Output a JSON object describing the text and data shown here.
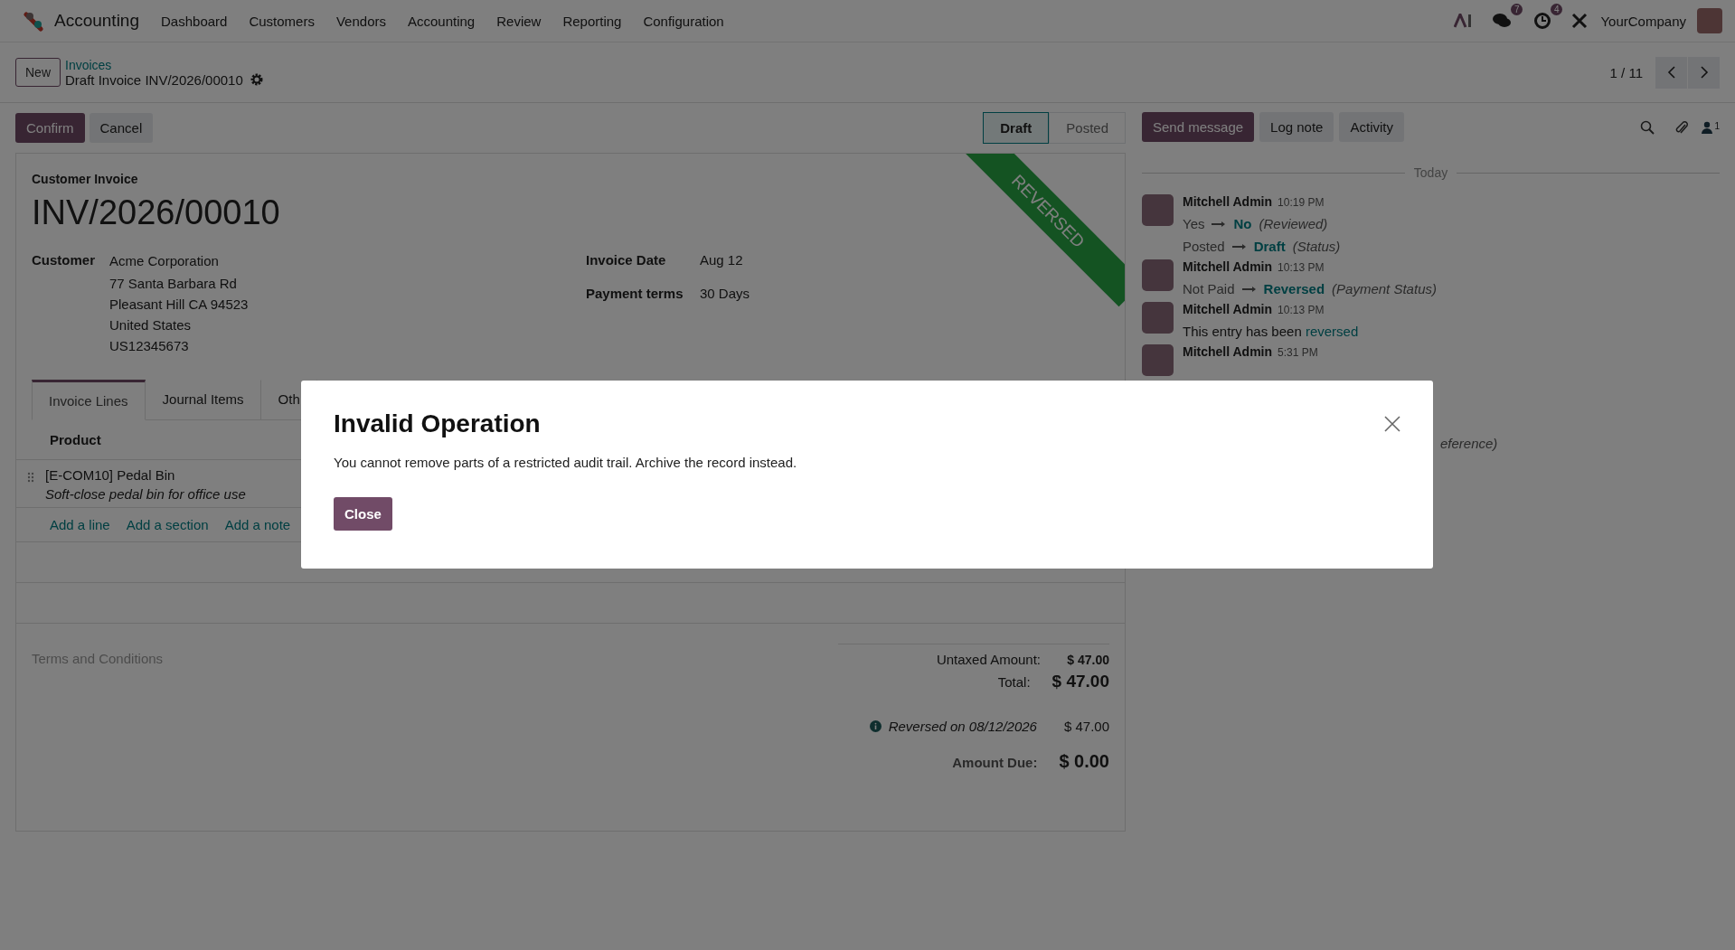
{
  "navbar": {
    "app_name": "Accounting",
    "menu": [
      "Dashboard",
      "Customers",
      "Vendors",
      "Accounting",
      "Review",
      "Reporting",
      "Configuration"
    ],
    "badges": [
      {
        "kind": "chat",
        "count": "7"
      },
      {
        "kind": "activity",
        "count": "4"
      }
    ],
    "company": "YourCompany"
  },
  "control_panel": {
    "new_button": "New",
    "breadcrumb": "Invoices",
    "record_title": "Draft Invoice INV/2026/00010",
    "pager": "1 / 11"
  },
  "actions": [
    {
      "label": "Confirm",
      "kind": "primary"
    },
    {
      "label": "Cancel",
      "kind": "secondary"
    }
  ],
  "statusbar": [
    {
      "label": "Draft",
      "selected": true
    },
    {
      "label": "Posted",
      "selected": false
    }
  ],
  "form": {
    "type_label": "Customer Invoice",
    "name": "INV/2026/00010",
    "ribbon": "REVERSED",
    "customer_label": "Customer",
    "customer_lines": [
      "Acme Corporation",
      "77 Santa Barbara Rd",
      "Pleasant Hill CA 94523",
      "United States",
      "US12345673"
    ],
    "fields": [
      {
        "label": "Invoice Date",
        "value": "Aug 12"
      },
      {
        "label": "Payment terms",
        "value": "30 Days"
      }
    ],
    "tabs": [
      {
        "label": "Invoice Lines",
        "selected": true
      },
      {
        "label": "Journal Items",
        "selected": false
      },
      {
        "label": "Oth",
        "selected": false
      }
    ],
    "column": "Product",
    "lines": [
      {
        "product": "[E-COM10] Pedal Bin",
        "description": "Soft-close pedal bin for office use"
      }
    ],
    "add_links": [
      "Add a line",
      "Add a section",
      "Add a note"
    ],
    "terms_placeholder": "Terms and Conditions",
    "totals": [
      {
        "kind": "subtotal",
        "label": "Untaxed Amount:",
        "value": "$ 47.00"
      },
      {
        "kind": "total",
        "label": "Total:",
        "value": "$ 47.00"
      }
    ],
    "payments": [
      {
        "label": "Reversed on 08/12/2026",
        "amount": "$ 47.00"
      }
    ],
    "amount_due": {
      "label": "Amount Due:",
      "value": "$ 0.00"
    }
  },
  "chatter": {
    "buttons": [
      {
        "label": "Send message",
        "kind": "primary"
      },
      {
        "label": "Log note",
        "kind": "secondary"
      },
      {
        "label": "Activity",
        "kind": "secondary"
      }
    ],
    "followers": "1",
    "day": "Today",
    "messages": [
      {
        "author": "Mitchell Admin",
        "time": "10:19 PM",
        "lines": [
          {
            "kind": "tracking",
            "old": "Yes",
            "new": "No",
            "field": "(Reviewed)"
          },
          {
            "kind": "tracking",
            "old": "Posted",
            "new": "Draft",
            "field": "(Status)"
          }
        ]
      },
      {
        "author": "Mitchell Admin",
        "time": "10:13 PM",
        "lines": [
          {
            "kind": "tracking",
            "old": "Not Paid",
            "new": "Reversed",
            "field": "(Payment Status)"
          }
        ]
      },
      {
        "author": "Mitchell Admin",
        "time": "10:13 PM",
        "lines": [
          {
            "kind": "text",
            "text": "This entry has been",
            "link": "reversed"
          }
        ]
      },
      {
        "author": "Mitchell Admin",
        "time": "5:31 PM"
      }
    ],
    "hidden_fragment": "eference)"
  },
  "dialog": {
    "title": "Invalid Operation",
    "body": "You cannot remove parts of a restricted audit trail. Archive the record instead.",
    "button": "Close"
  }
}
